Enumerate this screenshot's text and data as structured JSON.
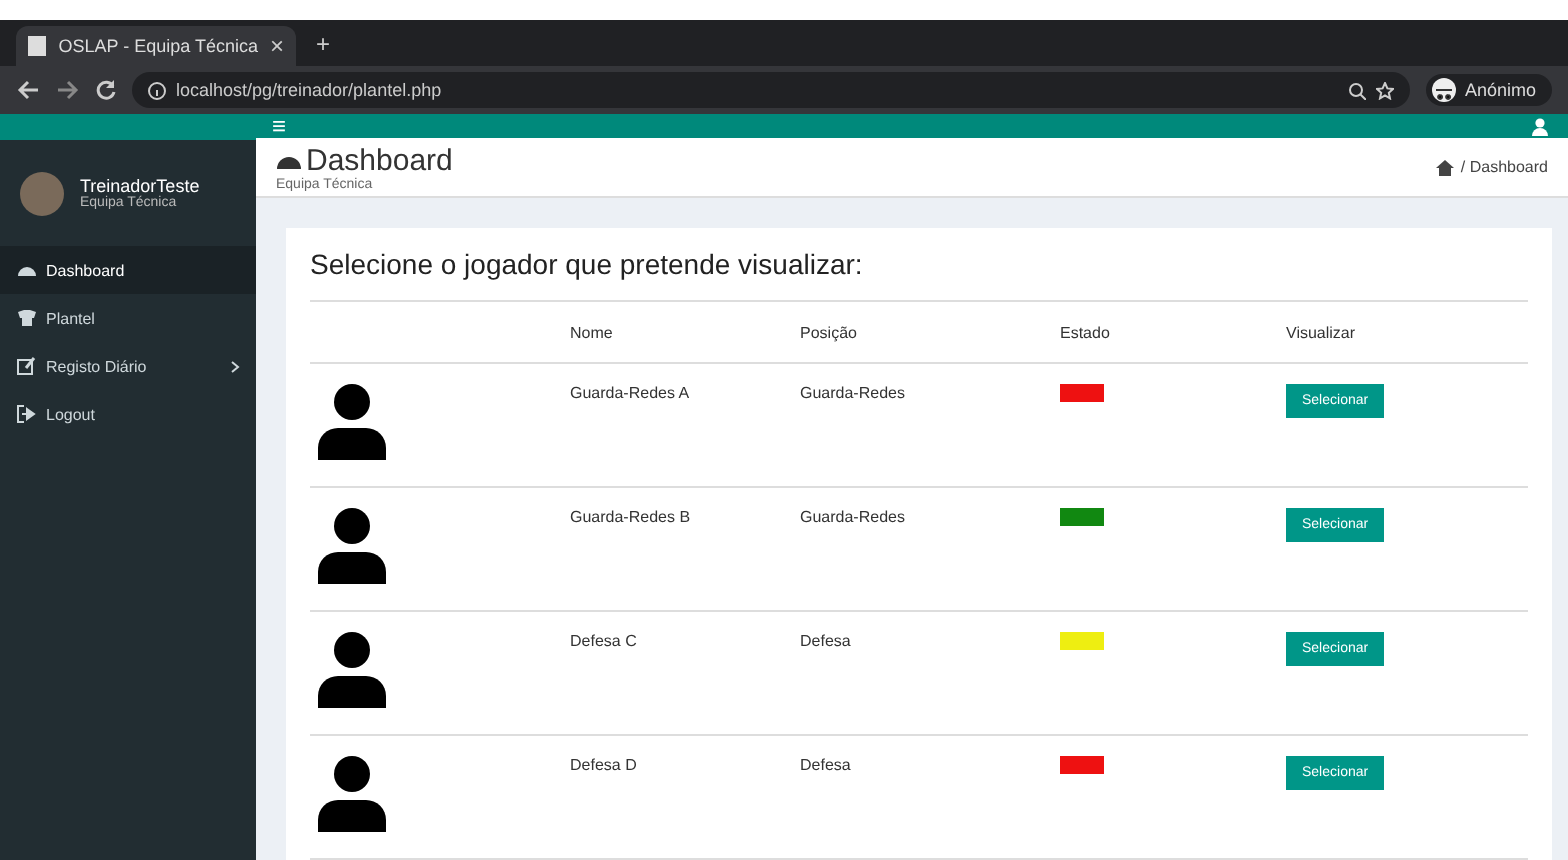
{
  "browser": {
    "tab_title": "OSLAP - Equipa Técnica",
    "tab_close": "×",
    "new_tab": "+",
    "url": "localhost/pg/treinador/plantel.php",
    "profile": "Anónimo"
  },
  "topbar": {
    "menu_toggle": "≡"
  },
  "sidebar": {
    "user_name": "TreinadorTeste",
    "user_role": "Equipa Técnica",
    "items": [
      {
        "label": "Dashboard",
        "selected": true,
        "has_arrow": false
      },
      {
        "label": "Plantel",
        "selected": false,
        "has_arrow": false
      },
      {
        "label": "Registo Diário",
        "selected": false,
        "has_arrow": true
      },
      {
        "label": "Logout",
        "selected": false,
        "has_arrow": false
      }
    ]
  },
  "header": {
    "title": "Dashboard",
    "subtitle": "Equipa Técnica",
    "breadcrumb": "/ Dashboard"
  },
  "card": {
    "title": "Selecione o jogador que pretende visualizar:",
    "columns": [
      "Nome",
      "Posição",
      "Estado",
      "Visualizar"
    ],
    "rows": [
      {
        "name": "Guarda-Redes A",
        "position": "Guarda-Redes",
        "color": "#ee1111",
        "button": "Selecionar"
      },
      {
        "name": "Guarda-Redes B",
        "position": "Guarda-Redes",
        "color": "#118811",
        "button": "Selecionar"
      },
      {
        "name": "Defesa C",
        "position": "Defesa",
        "color": "#eeee11",
        "button": "Selecionar"
      },
      {
        "name": "Defesa D",
        "position": "Defesa",
        "color": "#ee1111",
        "button": "Selecionar"
      }
    ]
  }
}
